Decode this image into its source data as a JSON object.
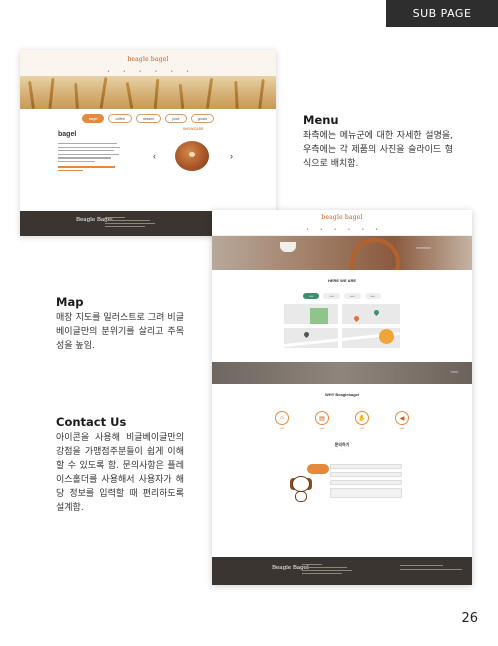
{
  "header": {
    "tag": "SUB PAGE"
  },
  "page_number": "26",
  "sections": {
    "menu": {
      "title": "Menu",
      "body": "좌측에는 메뉴군에 대한 자세한 설명을, 우측에는 각 제품의 사진을 슬라이드 형식으로 배치함."
    },
    "map": {
      "title": "Map",
      "body": "매장 지도를 일러스트로 그려 비글베이글만의 분위기를 살리고 주목성을 높임."
    },
    "contact": {
      "title": "Contact Us",
      "body": "아이콘을 사용해 비글베이글만의 강점을 가맹점주분들이 쉽게 이해할 수 있도록 함. 문의사항은 플레이스홀더를 사용해서 사용자가 해당 정보를 입력할 때 편리하도록 설계함."
    }
  },
  "shot1": {
    "logo": "beagle bagel",
    "tabs": [
      {
        "label": "bagel",
        "active": true
      },
      {
        "label": "coffee",
        "active": false
      },
      {
        "label": "dessert",
        "active": false
      },
      {
        "label": "juice",
        "active": false
      },
      {
        "label": "goods",
        "active": false
      }
    ],
    "menu_title": "bagel",
    "card_label": "SHOWCASE",
    "footer_logo": "Beagle Bagel"
  },
  "shot2": {
    "logo": "beagle bagel",
    "map_title": "HERE WE ARE",
    "why_title": "WHY Beaglebagel",
    "inquiry_title": "문의하기",
    "footer_logo": "Beagle Bagel"
  },
  "colors": {
    "accent": "#e58a3c",
    "brand": "#c9581c",
    "dark": "#3a3530",
    "tag_bg": "#2e2e2e"
  }
}
